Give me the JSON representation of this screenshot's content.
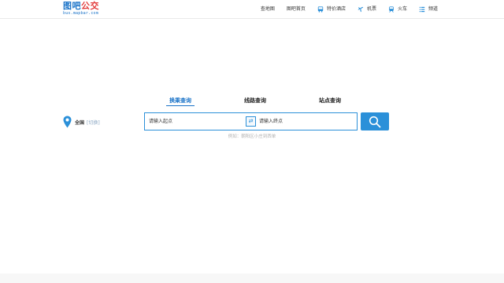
{
  "logo": {
    "title_a": "图吧",
    "title_b": "公交",
    "subtitle": "bus.mapbar.com"
  },
  "nav": {
    "items": [
      {
        "label": "查地图",
        "icon": ""
      },
      {
        "label": "图吧首页",
        "icon": ""
      },
      {
        "label": "特价酒店",
        "icon": "bus-icon"
      },
      {
        "label": "机票",
        "icon": "plane-icon"
      },
      {
        "label": "火车",
        "icon": "train-icon"
      },
      {
        "label": "频道",
        "icon": "menu-icon"
      }
    ]
  },
  "tabs": [
    {
      "label": "换乘查询",
      "active": true
    },
    {
      "label": "线路查询",
      "active": false
    },
    {
      "label": "站点查询",
      "active": false
    }
  ],
  "city": {
    "name": "全国",
    "switch_label": "[切换]"
  },
  "search": {
    "from_placeholder": "请输入起点",
    "to_placeholder": "请输入终点",
    "swap_symbol": "⇄"
  },
  "example": {
    "text": "例如：朝阳区小庄到西单"
  },
  "colors": {
    "accent": "#2b90d9",
    "logo_blue": "#1a73c8",
    "logo_red": "#e23b3b"
  }
}
